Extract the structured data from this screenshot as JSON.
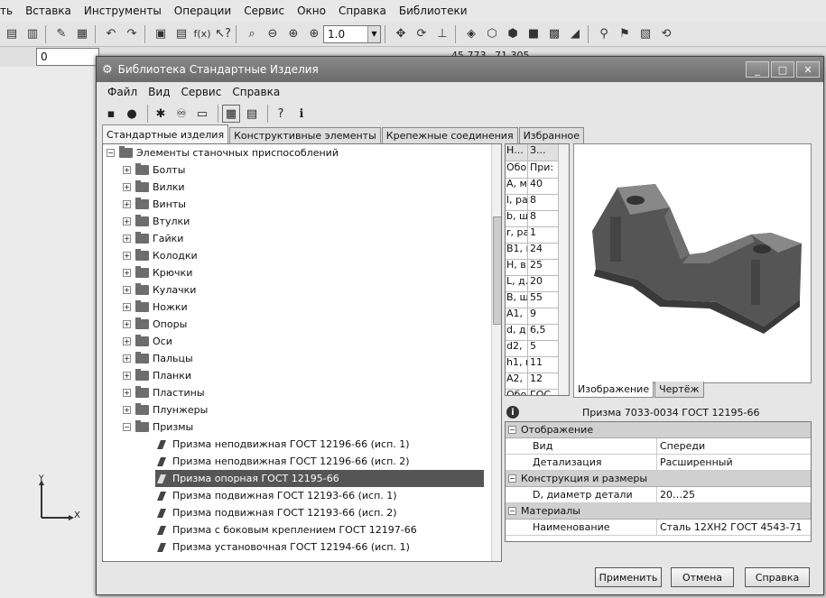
{
  "main_menu": [
    "ть",
    "Вставка",
    "Инструменты",
    "Операции",
    "Сервис",
    "Окно",
    "Справка",
    "Библиотеки"
  ],
  "main_toolbar": {
    "zoom_value": "1.0",
    "layer_value": "0",
    "coord_x": "45.773",
    "coord_y": "71.305"
  },
  "axes": {
    "x": "X",
    "y": "Y"
  },
  "window": {
    "title": "Библиотека Стандартные Изделия",
    "minimize": "_",
    "maximize": "□",
    "close": "✕",
    "menu": [
      "Файл",
      "Вид",
      "Сервис",
      "Справка"
    ],
    "tabs": [
      "Стандартные изделия",
      "Конструктивные элементы",
      "Крепежные соединения",
      "Избранное"
    ]
  },
  "tree": {
    "root": "Элементы станочных приспособлений",
    "folders": [
      "Болты",
      "Вилки",
      "Винты",
      "Втулки",
      "Гайки",
      "Колодки",
      "Крючки",
      "Кулачки",
      "Ножки",
      "Опоры",
      "Оси",
      "Пальцы",
      "Планки",
      "Пластины",
      "Плунжеры",
      "Призмы"
    ],
    "items": [
      "Призма неподвижная ГОСТ 12196-66 (исп. 1)",
      "Призма неподвижная ГОСТ 12196-66 (исп. 2)",
      "Призма опорная ГОСТ 12195-66",
      "Призма подвижная ГОСТ 12193-66 (исп. 1)",
      "Призма подвижная ГОСТ 12193-66 (исп. 2)",
      "Призма с боковым креплением ГОСТ 12197-66",
      "Призма установочная ГОСТ 12194-66 (исп. 1)"
    ]
  },
  "params": {
    "header": [
      "Н...",
      "З..."
    ],
    "rows": [
      [
        "Обо",
        "При:"
      ],
      [
        "A, м",
        "40"
      ],
      [
        "l, ра",
        "8"
      ],
      [
        "b, ш",
        "8"
      ],
      [
        "r, ра",
        "1"
      ],
      [
        "B1, ı",
        "24"
      ],
      [
        "H, в",
        "25"
      ],
      [
        "L, д.",
        "20"
      ],
      [
        "B, ш",
        "55"
      ],
      [
        "A1,",
        "9"
      ],
      [
        "d, д",
        "6,5"
      ],
      [
        "d2,",
        "5"
      ],
      [
        "h1, ı",
        "11"
      ],
      [
        "A2,",
        "12"
      ],
      [
        "Обо",
        "ГОС"
      ]
    ]
  },
  "image_tabs": [
    "Изображение",
    "Чертёж"
  ],
  "selected_title": "Призма 7033-0034 ГОСТ 12195-66",
  "properties": {
    "groups": [
      {
        "name": "Отображение",
        "rows": [
          [
            "Вид",
            "Спереди"
          ],
          [
            "Детализация",
            "Расширенный"
          ]
        ]
      },
      {
        "name": "Конструкция и размеры",
        "rows": [
          [
            "D, диаметр детали",
            "20…25"
          ]
        ]
      },
      {
        "name": "Материалы",
        "rows": [
          [
            "Наименование",
            "Сталь 12ХН2 ГОСТ 4543-71"
          ]
        ]
      }
    ]
  },
  "buttons": {
    "apply": "Применить",
    "cancel": "Отмена",
    "help": "Справка"
  }
}
